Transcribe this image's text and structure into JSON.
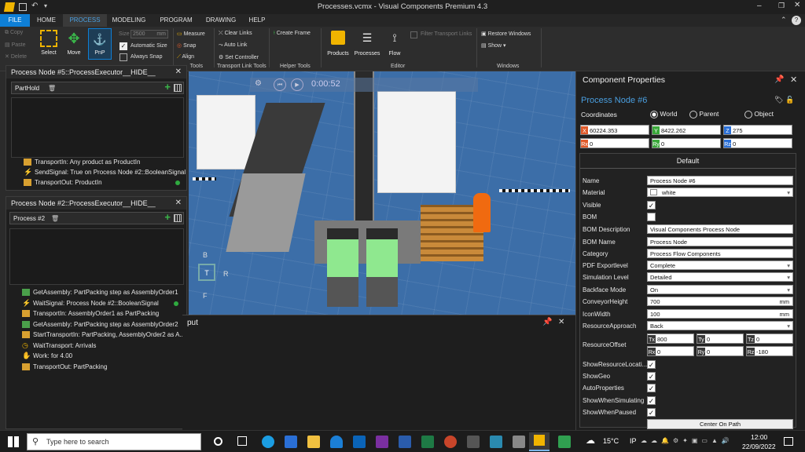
{
  "window": {
    "title": "Processes.vcmx - Visual Components Premium 4.3"
  },
  "menu": {
    "tabs": [
      "FILE",
      "HOME",
      "PROCESS",
      "MODELING",
      "PROGRAM",
      "DRAWING",
      "HELP"
    ]
  },
  "ribbon": {
    "copy": "Copy",
    "paste": "Paste",
    "delete": "Delete",
    "select": "Select",
    "move": "Move",
    "pnp": "PnP",
    "size_label": "Size",
    "size_value": "2500",
    "size_unit": "mm",
    "automatic_size": "Automatic Size",
    "always_snap": "Always Snap",
    "measure": "Measure",
    "snap": "Snap",
    "align": "Align",
    "clear_links": "Clear Links",
    "auto_link": "Auto Link",
    "set_controller": "Set Controller",
    "create_frame": "Create Frame",
    "products": "Products",
    "processes": "Processes",
    "flow": "Flow",
    "filter_transport_links": "Filter Transport Links",
    "restore_windows": "Restore Windows",
    "show": "Show ▾",
    "groups": {
      "tools": "Tools",
      "transport_link_tools": "Transport Link Tools",
      "helper_tools": "Helper Tools",
      "editor": "Editor",
      "windows": "Windows"
    }
  },
  "panel1": {
    "title": "Process Node #5::ProcessExecutor__HIDE__",
    "tab": "PartHold",
    "statements": [
      "TransportIn: Any product as ProductIn",
      "SendSignal: True on Process Node #2::BooleanSignal",
      "TransportOut: ProductIn"
    ]
  },
  "panel2": {
    "title": "Process Node #2::ProcessExecutor__HIDE__",
    "tab": "Process #2",
    "statements": [
      "GetAssembly: PartPacking step as AssemblyOrder1",
      "WaitSignal: Process Node #2::BooleanSignal",
      "TransportIn: AssemblyOrder1 as PartPacking",
      "GetAssembly: PartPacking step as AssemblyOrder2",
      "StartTransportIn: PartPacking, AssemblyOrder2 as A...",
      "WaitTransport: Arrivals",
      "Work: for 4.00",
      "TransportOut: PartPacking"
    ]
  },
  "viewport": {
    "time": "0:00:52",
    "nav_cube": {
      "top": "B",
      "front": "T",
      "right": "R",
      "bottom": "F"
    }
  },
  "output": {
    "title": "Output",
    "visible_title": "put"
  },
  "properties": {
    "panel_title": "Component Properties",
    "component_name": "Process Node #6",
    "coordinates_label": "Coordinates",
    "coord_options": [
      "World",
      "Parent",
      "Object"
    ],
    "coord_selected": "World",
    "x": "60224.353",
    "y": "8422.262",
    "z": "275",
    "rx": "0",
    "ry": "0",
    "rz": "0",
    "section": "Default",
    "name_label": "Name",
    "name": "Process Node #6",
    "material_label": "Material",
    "material": "white",
    "visible_label": "Visible",
    "visible": true,
    "bom_label": "BOM",
    "bom": false,
    "bom_desc_label": "BOM Description",
    "bom_desc": "Visual Components Process Node",
    "bom_name_label": "BOM Name",
    "bom_name": "Process Node",
    "category_label": "Category",
    "category": "Process Flow Components",
    "pdf_label": "PDF Exportlevel",
    "pdf": "Complete",
    "sim_label": "Simulation Level",
    "sim": "Detailed",
    "backface_label": "Backface Mode",
    "backface": "On",
    "conveyor_label": "ConveyorHeight",
    "conveyor": "700",
    "icon_label": "IconWidth",
    "icon": "100",
    "unit_mm": "mm",
    "approach_label": "ResourceApproach",
    "approach": "Back",
    "offset_label": "ResourceOffset",
    "tx": "800",
    "ty": "0",
    "tz": "0",
    "orx": "0",
    "ory": "0",
    "orz": "-180",
    "show_res_label": "ShowResourceLocati...",
    "showgeo_label": "ShowGeo",
    "autoprops_label": "AutoProperties",
    "showsim_label": "ShowWhenSimulating",
    "showpaused_label": "ShowWhenPaused",
    "center_button": "Center On Path"
  },
  "taskbar": {
    "search_placeholder": "Type here to search",
    "temperature": "15°C",
    "lang": "IP",
    "time": "12:00",
    "date": "22/09/2022"
  },
  "colors": {
    "accent": "#0e7fd6",
    "x_tag": "#e05a2a",
    "y_tag": "#3aa83a",
    "z_tag": "#2a6fd6",
    "link_blue": "#4a9fe0"
  }
}
